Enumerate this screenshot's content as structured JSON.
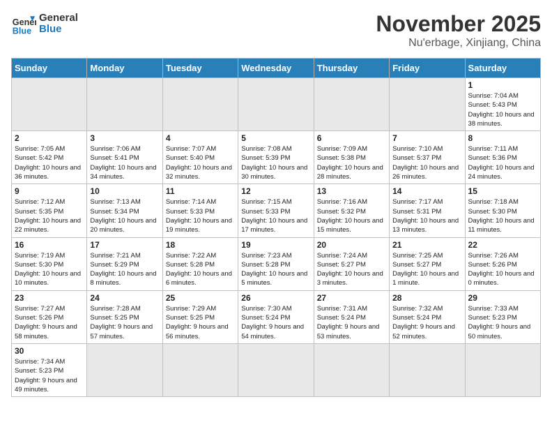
{
  "logo": {
    "text_general": "General",
    "text_blue": "Blue"
  },
  "calendar": {
    "title": "November 2025",
    "subtitle": "Nu'erbage, Xinjiang, China",
    "headers": [
      "Sunday",
      "Monday",
      "Tuesday",
      "Wednesday",
      "Thursday",
      "Friday",
      "Saturday"
    ],
    "weeks": [
      [
        {
          "day": "",
          "info": ""
        },
        {
          "day": "",
          "info": ""
        },
        {
          "day": "",
          "info": ""
        },
        {
          "day": "",
          "info": ""
        },
        {
          "day": "",
          "info": ""
        },
        {
          "day": "",
          "info": ""
        },
        {
          "day": "1",
          "info": "Sunrise: 7:04 AM\nSunset: 5:43 PM\nDaylight: 10 hours and 38 minutes."
        }
      ],
      [
        {
          "day": "2",
          "info": "Sunrise: 7:05 AM\nSunset: 5:42 PM\nDaylight: 10 hours and 36 minutes."
        },
        {
          "day": "3",
          "info": "Sunrise: 7:06 AM\nSunset: 5:41 PM\nDaylight: 10 hours and 34 minutes."
        },
        {
          "day": "4",
          "info": "Sunrise: 7:07 AM\nSunset: 5:40 PM\nDaylight: 10 hours and 32 minutes."
        },
        {
          "day": "5",
          "info": "Sunrise: 7:08 AM\nSunset: 5:39 PM\nDaylight: 10 hours and 30 minutes."
        },
        {
          "day": "6",
          "info": "Sunrise: 7:09 AM\nSunset: 5:38 PM\nDaylight: 10 hours and 28 minutes."
        },
        {
          "day": "7",
          "info": "Sunrise: 7:10 AM\nSunset: 5:37 PM\nDaylight: 10 hours and 26 minutes."
        },
        {
          "day": "8",
          "info": "Sunrise: 7:11 AM\nSunset: 5:36 PM\nDaylight: 10 hours and 24 minutes."
        }
      ],
      [
        {
          "day": "9",
          "info": "Sunrise: 7:12 AM\nSunset: 5:35 PM\nDaylight: 10 hours and 22 minutes."
        },
        {
          "day": "10",
          "info": "Sunrise: 7:13 AM\nSunset: 5:34 PM\nDaylight: 10 hours and 20 minutes."
        },
        {
          "day": "11",
          "info": "Sunrise: 7:14 AM\nSunset: 5:33 PM\nDaylight: 10 hours and 19 minutes."
        },
        {
          "day": "12",
          "info": "Sunrise: 7:15 AM\nSunset: 5:33 PM\nDaylight: 10 hours and 17 minutes."
        },
        {
          "day": "13",
          "info": "Sunrise: 7:16 AM\nSunset: 5:32 PM\nDaylight: 10 hours and 15 minutes."
        },
        {
          "day": "14",
          "info": "Sunrise: 7:17 AM\nSunset: 5:31 PM\nDaylight: 10 hours and 13 minutes."
        },
        {
          "day": "15",
          "info": "Sunrise: 7:18 AM\nSunset: 5:30 PM\nDaylight: 10 hours and 11 minutes."
        }
      ],
      [
        {
          "day": "16",
          "info": "Sunrise: 7:19 AM\nSunset: 5:30 PM\nDaylight: 10 hours and 10 minutes."
        },
        {
          "day": "17",
          "info": "Sunrise: 7:21 AM\nSunset: 5:29 PM\nDaylight: 10 hours and 8 minutes."
        },
        {
          "day": "18",
          "info": "Sunrise: 7:22 AM\nSunset: 5:28 PM\nDaylight: 10 hours and 6 minutes."
        },
        {
          "day": "19",
          "info": "Sunrise: 7:23 AM\nSunset: 5:28 PM\nDaylight: 10 hours and 5 minutes."
        },
        {
          "day": "20",
          "info": "Sunrise: 7:24 AM\nSunset: 5:27 PM\nDaylight: 10 hours and 3 minutes."
        },
        {
          "day": "21",
          "info": "Sunrise: 7:25 AM\nSunset: 5:27 PM\nDaylight: 10 hours and 1 minute."
        },
        {
          "day": "22",
          "info": "Sunrise: 7:26 AM\nSunset: 5:26 PM\nDaylight: 10 hours and 0 minutes."
        }
      ],
      [
        {
          "day": "23",
          "info": "Sunrise: 7:27 AM\nSunset: 5:26 PM\nDaylight: 9 hours and 58 minutes."
        },
        {
          "day": "24",
          "info": "Sunrise: 7:28 AM\nSunset: 5:25 PM\nDaylight: 9 hours and 57 minutes."
        },
        {
          "day": "25",
          "info": "Sunrise: 7:29 AM\nSunset: 5:25 PM\nDaylight: 9 hours and 56 minutes."
        },
        {
          "day": "26",
          "info": "Sunrise: 7:30 AM\nSunset: 5:24 PM\nDaylight: 9 hours and 54 minutes."
        },
        {
          "day": "27",
          "info": "Sunrise: 7:31 AM\nSunset: 5:24 PM\nDaylight: 9 hours and 53 minutes."
        },
        {
          "day": "28",
          "info": "Sunrise: 7:32 AM\nSunset: 5:24 PM\nDaylight: 9 hours and 52 minutes."
        },
        {
          "day": "29",
          "info": "Sunrise: 7:33 AM\nSunset: 5:23 PM\nDaylight: 9 hours and 50 minutes."
        }
      ],
      [
        {
          "day": "30",
          "info": "Sunrise: 7:34 AM\nSunset: 5:23 PM\nDaylight: 9 hours and 49 minutes."
        },
        {
          "day": "",
          "info": ""
        },
        {
          "day": "",
          "info": ""
        },
        {
          "day": "",
          "info": ""
        },
        {
          "day": "",
          "info": ""
        },
        {
          "day": "",
          "info": ""
        },
        {
          "day": "",
          "info": ""
        }
      ]
    ]
  }
}
